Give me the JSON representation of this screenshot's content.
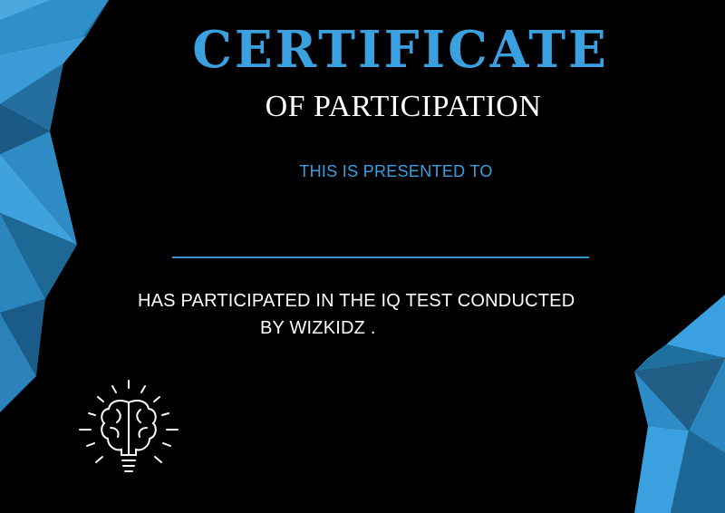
{
  "certificate": {
    "title": "CERTIFICATE",
    "subtitle": "OF PARTICIPATION",
    "presented_to": "THIS IS PRESENTED TO",
    "body_line1": "HAS PARTICIPATED IN THE IQ TEST CONDUCTED",
    "body_line2": "BY WIZKIDZ ."
  },
  "colors": {
    "background": "#000000",
    "accent_blue": "#3aa0e0",
    "text_white": "#ffffff"
  },
  "icons": {
    "logo": "brain-lightbulb-icon"
  }
}
